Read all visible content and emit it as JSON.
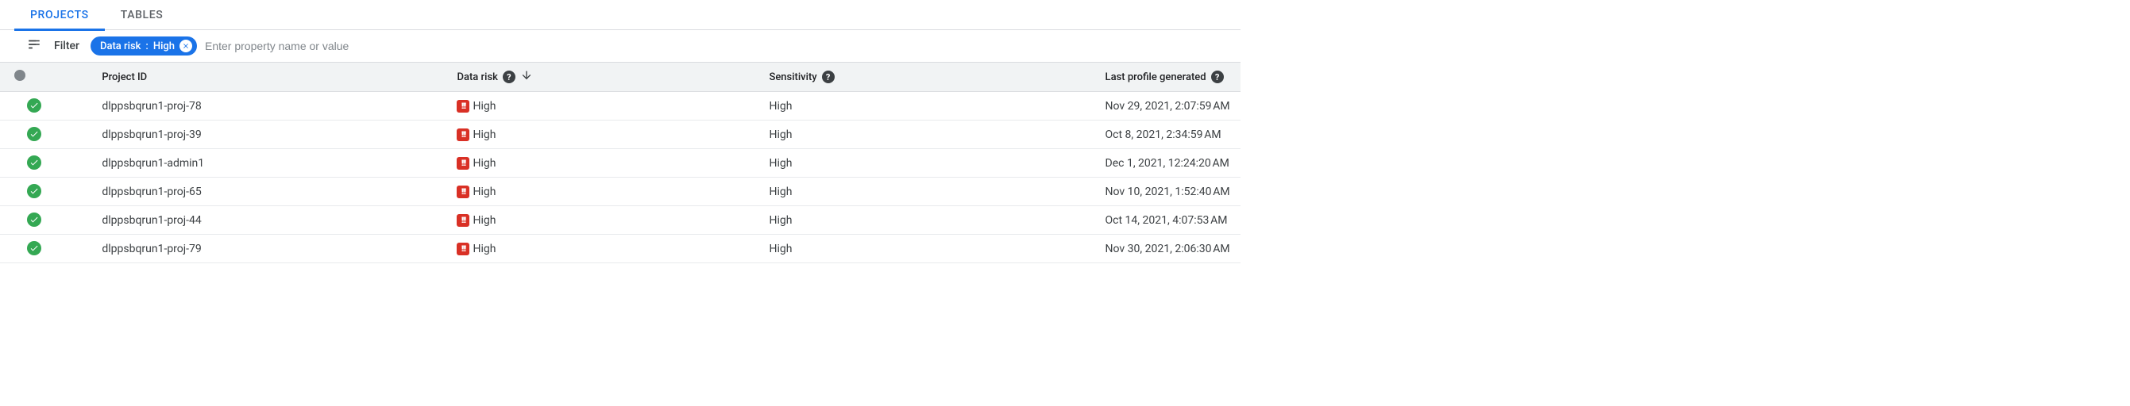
{
  "tabs": [
    {
      "label": "PROJECTS",
      "active": true
    },
    {
      "label": "TABLES",
      "active": false
    }
  ],
  "filter": {
    "label": "Filter",
    "chip": {
      "key": "Data risk",
      "sep": " : ",
      "value": "High"
    },
    "placeholder": "Enter property name or value"
  },
  "columns": {
    "project_id": "Project ID",
    "data_risk": "Data risk",
    "sensitivity": "Sensitivity",
    "last_profile": "Last profile generated"
  },
  "rows": [
    {
      "project_id": "dlppsbqrun1-proj-78",
      "data_risk": "High",
      "sensitivity": "High",
      "last_profile": "Nov 29, 2021, 2:07:59 AM"
    },
    {
      "project_id": "dlppsbqrun1-proj-39",
      "data_risk": "High",
      "sensitivity": "High",
      "last_profile": "Oct 8, 2021, 2:34:59 AM"
    },
    {
      "project_id": "dlppsbqrun1-admin1",
      "data_risk": "High",
      "sensitivity": "High",
      "last_profile": "Dec 1, 2021, 12:24:20 AM"
    },
    {
      "project_id": "dlppsbqrun1-proj-65",
      "data_risk": "High",
      "sensitivity": "High",
      "last_profile": "Nov 10, 2021, 1:52:40 AM"
    },
    {
      "project_id": "dlppsbqrun1-proj-44",
      "data_risk": "High",
      "sensitivity": "High",
      "last_profile": "Oct 14, 2021, 4:07:53 AM"
    },
    {
      "project_id": "dlppsbqrun1-proj-79",
      "data_risk": "High",
      "sensitivity": "High",
      "last_profile": "Nov 30, 2021, 2:06:30 AM"
    }
  ]
}
